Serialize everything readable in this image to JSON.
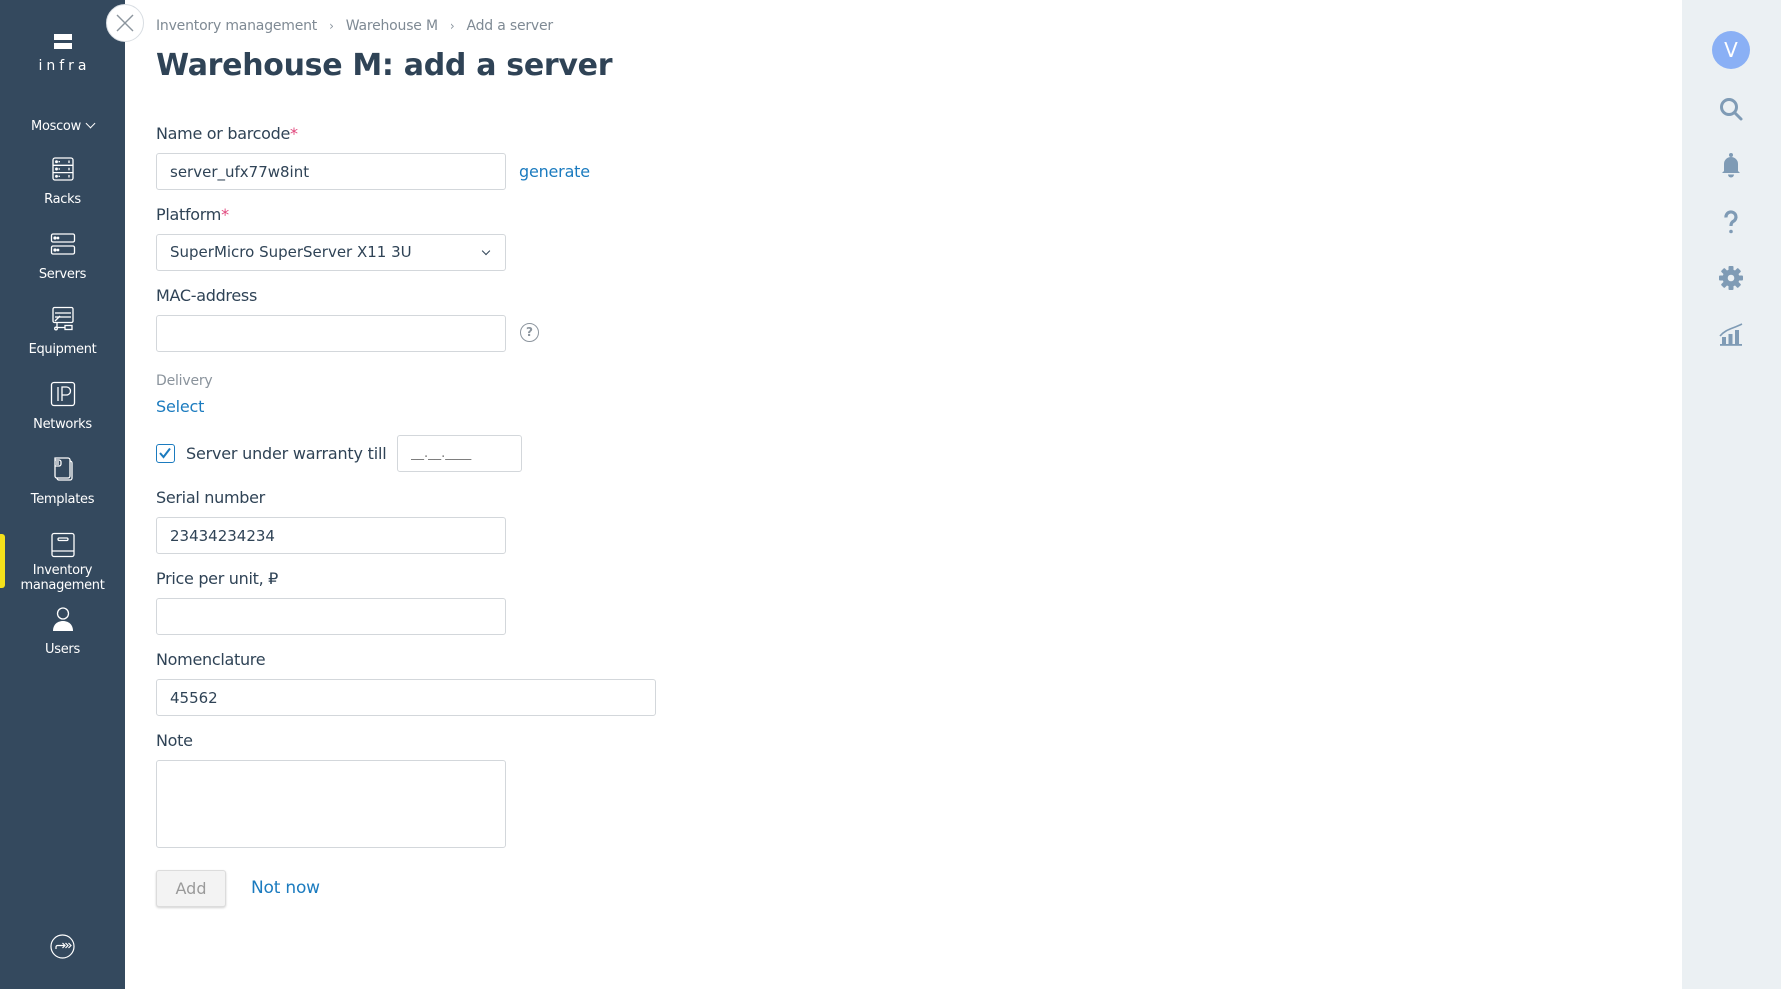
{
  "sidebar": {
    "logo_text": "infra",
    "city": "Moscow",
    "items": [
      {
        "label": "Racks",
        "icon": "rack-icon"
      },
      {
        "label": "Servers",
        "icon": "servers-icon"
      },
      {
        "label": "Equipment",
        "icon": "equipment-icon"
      },
      {
        "label": "Networks",
        "icon": "ip-icon"
      },
      {
        "label": "Templates",
        "icon": "templates-icon"
      },
      {
        "label": "Inventory management",
        "icon": "inventory-icon",
        "active": true
      },
      {
        "label": "Users",
        "icon": "user-icon"
      }
    ],
    "active_color": "#f5e11b",
    "bottom_icon": "logout-icon"
  },
  "breadcrumb": [
    "Inventory management",
    "Warehouse M",
    "Add a server"
  ],
  "page_title": "Warehouse M: add a server",
  "form": {
    "name": {
      "label": "Name or barcode",
      "required": "*",
      "value": "server_ufx77w8int",
      "action": "generate"
    },
    "platform": {
      "label": "Platform",
      "required": "*",
      "value": "SuperMicro SuperServer X11 3U"
    },
    "mac": {
      "label": "MAC-address",
      "value": "",
      "help": "?"
    },
    "delivery": {
      "label": "Delivery",
      "action": "Select"
    },
    "warranty": {
      "checked": true,
      "label": "Server under warranty  till",
      "placeholder": "__.__.____"
    },
    "serial": {
      "label": "Serial number",
      "value": "23434234234"
    },
    "price": {
      "label": "Price per unit, ₽",
      "value": ""
    },
    "nomenclature": {
      "label": "Nomenclature",
      "value": "45562"
    },
    "note": {
      "label": "Note",
      "value": ""
    },
    "add_label": "Add",
    "cancel_label": "Not now"
  },
  "rail": {
    "avatar_initial": "V",
    "avatar_color": "#8ab0f5",
    "icons": [
      "search-icon",
      "bell-icon",
      "help-icon",
      "gear-icon",
      "analytics-icon"
    ]
  },
  "colors": {
    "sidebar_bg": "#34495e",
    "link": "#1b7bbf",
    "required": "#e0457b",
    "rail_bg": "#ebf0f3",
    "rail_icon": "#7f9bb5"
  }
}
